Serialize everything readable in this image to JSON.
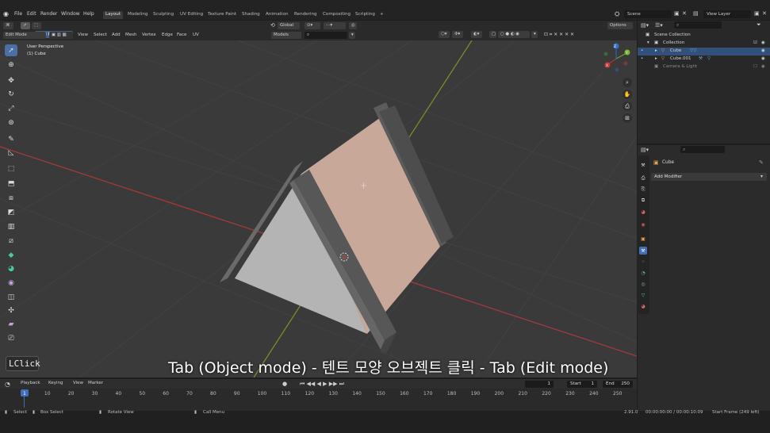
{
  "menu": {
    "items": [
      "File",
      "Edit",
      "Render",
      "Window",
      "Help"
    ],
    "workspaces": [
      "Layout",
      "Modeling",
      "Sculpting",
      "UV Editing",
      "Texture Paint",
      "Shading",
      "Animation",
      "Rendering",
      "Compositing",
      "Scripting"
    ],
    "active_workspace": "Layout",
    "add_tab": "+",
    "scene": "Scene",
    "view_layer": "View Layer"
  },
  "header": {
    "mode": "Edit Mode",
    "menus": [
      "View",
      "Select",
      "Add",
      "Mesh",
      "Vertex",
      "Edge",
      "Face",
      "UV"
    ],
    "orientation": "Global",
    "models": "Models",
    "options": "Options"
  },
  "viewport": {
    "info_line1": "User Perspective",
    "info_line2": "(1) Cube",
    "gizmo": {
      "x": "X",
      "y": "Y",
      "z": "Z"
    },
    "subtitle": "Tab (Object mode) - 텐트 모양 오브젝트 클릭 - Tab (Edit mode)",
    "key_overlay": "LClick",
    "colors": {
      "background": "#3a3a3a",
      "grid": "#444444",
      "x_axis": "#a23a3a",
      "y_axis": "#7d8a2a",
      "face_selected": "#c8a898",
      "face_light": "#b4b4b4",
      "frame_dark": "#5a5a5a"
    }
  },
  "toolbar": {
    "tools": [
      "select-box",
      "cursor",
      "move",
      "rotate",
      "scale",
      "transform",
      "annotate",
      "measure",
      "add-cube",
      "extrude",
      "inset",
      "bevel",
      "loop-cut",
      "knife",
      "poly-build",
      "spin",
      "smooth",
      "edge-slide",
      "shrink-fatten",
      "shear",
      "rip"
    ]
  },
  "timeline": {
    "menus": [
      "Playback",
      "Keying",
      "View",
      "Marker"
    ],
    "current_frame": "1",
    "start_label": "Start",
    "start": "1",
    "end_label": "End",
    "end": "250",
    "ticks": [
      "1",
      "10",
      "20",
      "30",
      "40",
      "50",
      "60",
      "70",
      "80",
      "90",
      "100",
      "110",
      "120",
      "130",
      "140",
      "150",
      "160",
      "170",
      "180",
      "190",
      "200",
      "210",
      "220",
      "230",
      "240",
      "250"
    ]
  },
  "outliner": {
    "rows": [
      {
        "label": "Scene Collection"
      },
      {
        "label": "Collection"
      },
      {
        "label": "Cube",
        "selected": true
      },
      {
        "label": "Cube.001"
      },
      {
        "label": "Camera & Light"
      }
    ]
  },
  "properties": {
    "object_name": "Cube",
    "add_modifier": "Add Modifier"
  },
  "status": {
    "select": "Select",
    "box_select": "Box Select",
    "rotate_view": "Rotate View",
    "call_menu": "Call Menu",
    "version": "2.91.0",
    "time": "00:00:00:00 / 00:00:10:09",
    "start_frame": "Start Frame (249 left)"
  }
}
